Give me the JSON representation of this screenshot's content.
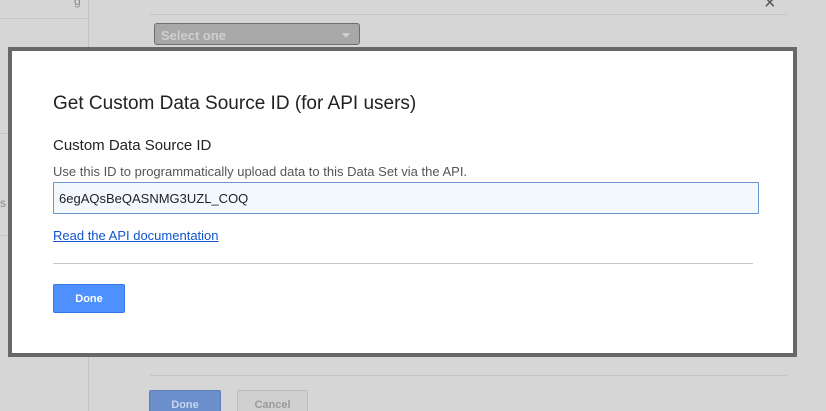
{
  "background": {
    "sidebar_fragments": [
      "g",
      "s"
    ],
    "select_placeholder": "Select one",
    "close_glyph": "×",
    "done_label": "Done",
    "cancel_label": "Cancel"
  },
  "modal": {
    "title": "Get Custom Data Source ID (for API users)",
    "field_label": "Custom Data Source ID",
    "field_help": "Use this ID to programmatically upload data to this Data Set via the API.",
    "id_value": "6egAQsBeQASNMG3UZL_COQ",
    "doc_link": "Read the API documentation",
    "done_label": "Done"
  },
  "colors": {
    "primary_button": "#4d90fe",
    "link": "#1155cc",
    "modal_border": "#686868",
    "overlay_background": "#d4d4d4"
  }
}
